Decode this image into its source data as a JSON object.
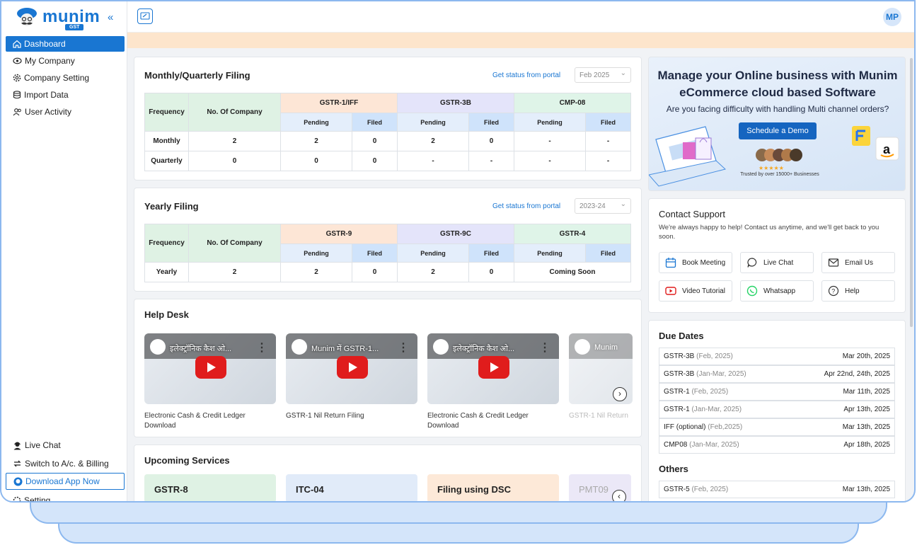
{
  "app": {
    "logo_text": "munim",
    "logo_badge": "GST",
    "collapse_icon": "«",
    "avatar": "MP"
  },
  "sidebar": {
    "items": [
      {
        "label": "Dashboard",
        "icon": "home-icon"
      },
      {
        "label": "My Company",
        "icon": "eye-icon"
      },
      {
        "label": "Company Setting",
        "icon": "gear-icon"
      },
      {
        "label": "Import Data",
        "icon": "database-icon"
      },
      {
        "label": "User Activity",
        "icon": "users-icon"
      }
    ],
    "bottom": [
      {
        "label": "Live Chat"
      },
      {
        "label": "Switch to A/c. & Billing"
      },
      {
        "label": "Download App Now"
      },
      {
        "label": "Setting"
      }
    ]
  },
  "monthly": {
    "title": "Monthly/Quarterly Filing",
    "portal": "Get status from portal",
    "period": "Feb 2025",
    "headers": {
      "frequency": "Frequency",
      "companies": "No. Of Company",
      "g1": "GSTR-1/IFF",
      "g2": "GSTR-3B",
      "g3": "CMP-08",
      "pending": "Pending",
      "filed": "Filed"
    },
    "rows": [
      [
        "Monthly",
        "2",
        "2",
        "0",
        "2",
        "0",
        "-",
        "-"
      ],
      [
        "Quarterly",
        "0",
        "0",
        "0",
        "-",
        "-",
        "-",
        "-"
      ]
    ]
  },
  "yearly": {
    "title": "Yearly Filing",
    "portal": "Get status from portal",
    "period": "2023-24",
    "headers": {
      "frequency": "Frequency",
      "companies": "No. Of Company",
      "g1": "GSTR-9",
      "g2": "GSTR-9C",
      "g3": "GSTR-4",
      "pending": "Pending",
      "filed": "Filed"
    },
    "rows": [
      [
        "Yearly",
        "2",
        "2",
        "0",
        "2",
        "0",
        "Coming Soon"
      ]
    ]
  },
  "helpdesk": {
    "title": "Help Desk",
    "videos": [
      {
        "thumb": "इलेक्ट्रॉनिक कैश ओ...",
        "caption": "Electronic Cash & Credit Ledger Download"
      },
      {
        "thumb": "Munim में GSTR-1...",
        "caption": "GSTR-1 Nil Return Filing"
      },
      {
        "thumb": "इलेक्ट्रॉनिक कैश ओ...",
        "caption": "Electronic Cash & Credit Ledger Download"
      },
      {
        "thumb": "Munim",
        "caption": "GSTR-1 Nil Return"
      }
    ]
  },
  "upcoming": {
    "title": "Upcoming Services",
    "items": [
      "GSTR-8",
      "ITC-04",
      "Filing using DSC",
      "PMT09"
    ]
  },
  "promo": {
    "heading": "Manage your Online business with Munim eCommerce cloud based Software",
    "sub": "Are you facing difficulty with handling Multi channel orders?",
    "button": "Schedule a Demo",
    "stars": "★★★★★",
    "trust": "Trusted by over 15000+ Businesses"
  },
  "support": {
    "title": "Contact Support",
    "text": "We're always happy to help! Contact us anytime, and we'll get back to you soon.",
    "buttons": [
      "Book Meeting",
      "Live Chat",
      "Email Us",
      "Video Tutorial",
      "Whatsapp",
      "Help"
    ]
  },
  "due": {
    "title": "Due Dates",
    "rows": [
      {
        "name": "GSTR-3B",
        "period": "(Feb, 2025)",
        "date": "Mar 20th, 2025"
      },
      {
        "name": "GSTR-3B",
        "period": "(Jan-Mar, 2025)",
        "date": "Apr 22nd, 24th, 2025"
      },
      {
        "name": "GSTR-1",
        "period": "(Feb, 2025)",
        "date": "Mar 11th, 2025"
      },
      {
        "name": "GSTR-1",
        "period": "(Jan-Mar, 2025)",
        "date": "Apr 13th, 2025"
      },
      {
        "name": "IFF (optional)",
        "period": "(Feb,2025)",
        "date": "Mar 13th, 2025"
      },
      {
        "name": "CMP08",
        "period": "(Jan-Mar, 2025)",
        "date": "Apr 18th, 2025"
      }
    ],
    "others_title": "Others",
    "others": [
      {
        "name": "GSTR-5",
        "period": "(Feb, 2025)",
        "date": "Mar 13th, 2025"
      }
    ]
  }
}
